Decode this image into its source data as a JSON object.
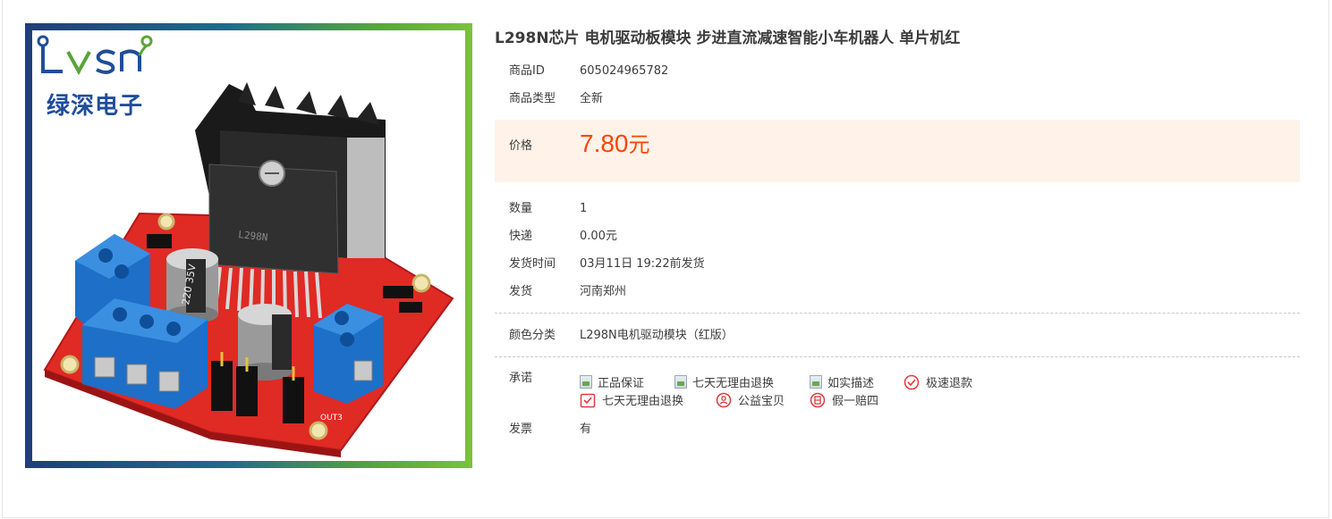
{
  "product": {
    "title": "L298N芯片 电机驱动板模块 步进直流减速智能小车机器人 单片机红",
    "image": {
      "brand_logo": "Lvsn",
      "brand_name": "绿深电子",
      "chip_marking": "L298N",
      "capacitor_marking": "220 35V",
      "connector_label": "OUT3"
    }
  },
  "specs": {
    "id_label": "商品ID",
    "id_value": "605024965782",
    "type_label": "商品类型",
    "type_value": "全新",
    "price_label": "价格",
    "price_value": "7.80",
    "price_unit": "元",
    "qty_label": "数量",
    "qty_value": "1",
    "shipping_label": "快递",
    "shipping_value": "0.00元",
    "ship_time_label": "发货时间",
    "ship_time_value": "03月11日 19:22前发货",
    "origin_label": "发货",
    "origin_value": "河南郑州",
    "color_label": "颜色分类",
    "color_value": "L298N电机驱动模块（红版）",
    "promise_label": "承诺",
    "invoice_label": "发票",
    "invoice_value": "有"
  },
  "promises": [
    {
      "label": "正品保证",
      "icon": "placeholder-image-icon"
    },
    {
      "label": "七天无理由退换",
      "icon": "placeholder-image-icon"
    },
    {
      "label": "如实描述",
      "icon": "placeholder-image-icon"
    },
    {
      "label": "极速退款",
      "icon": "check-circle-icon"
    },
    {
      "label": "七天无理由退换",
      "icon": "return-box-icon"
    },
    {
      "label": "公益宝贝",
      "icon": "charity-icon"
    },
    {
      "label": "假一赔四",
      "icon": "compensation-icon"
    }
  ],
  "colors": {
    "price": "#ff4400",
    "price_band": "#fff2e8",
    "accent_red": "#e4393c"
  }
}
